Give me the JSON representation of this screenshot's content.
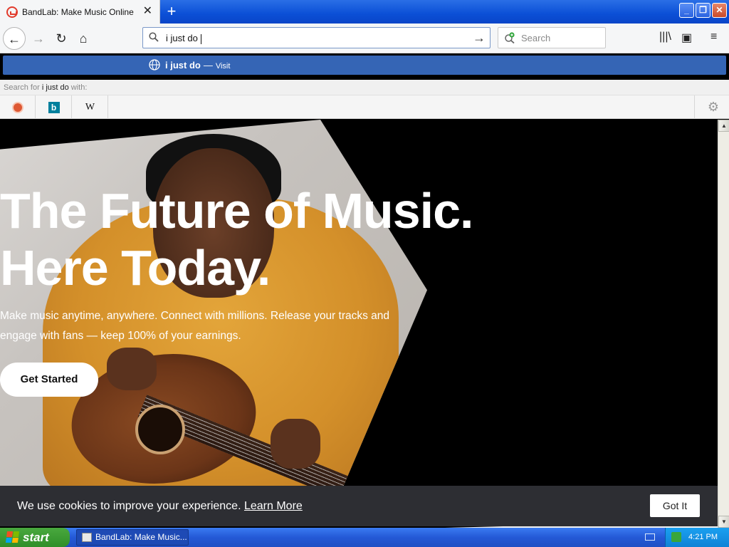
{
  "browser": {
    "tab_title": "BandLab: Make Music Online",
    "new_tab_symbol": "+",
    "url_value": "i just do",
    "search_placeholder": "Search"
  },
  "autocomplete": {
    "suggestion": "i just do",
    "dash": "—",
    "visit": "Visit",
    "search_for_prefix": "Search for",
    "search_for_term": "i just do",
    "search_for_suffix": "with:",
    "engines": [
      "DuckDuckGo",
      "Bing",
      "Wikipedia"
    ],
    "bing_letter": "b",
    "wiki_letter": "W"
  },
  "hero": {
    "headline_line1": "The Future of Music.",
    "headline_line2": "Here Today.",
    "subcopy": "Make music anytime, anywhere. Connect with millions. Release your tracks and engage with fans — keep 100% of your earnings.",
    "cta": "Get Started"
  },
  "cookie": {
    "message": "We use cookies to improve your experience.",
    "link": "Learn More",
    "button": "Got It"
  },
  "taskbar": {
    "start": "start",
    "task": "BandLab: Make Music...",
    "clock": "4:21 PM"
  },
  "icons": {
    "back": "←",
    "forward": "→",
    "reload": "↻",
    "home": "⌂",
    "go": "→",
    "library": "|||\\",
    "sidebar": "▣",
    "menu": "≡",
    "gear": "⚙",
    "minimize": "_",
    "maximize": "❐",
    "close": "✕",
    "scroll_up": "▲",
    "scroll_down": "▼"
  }
}
